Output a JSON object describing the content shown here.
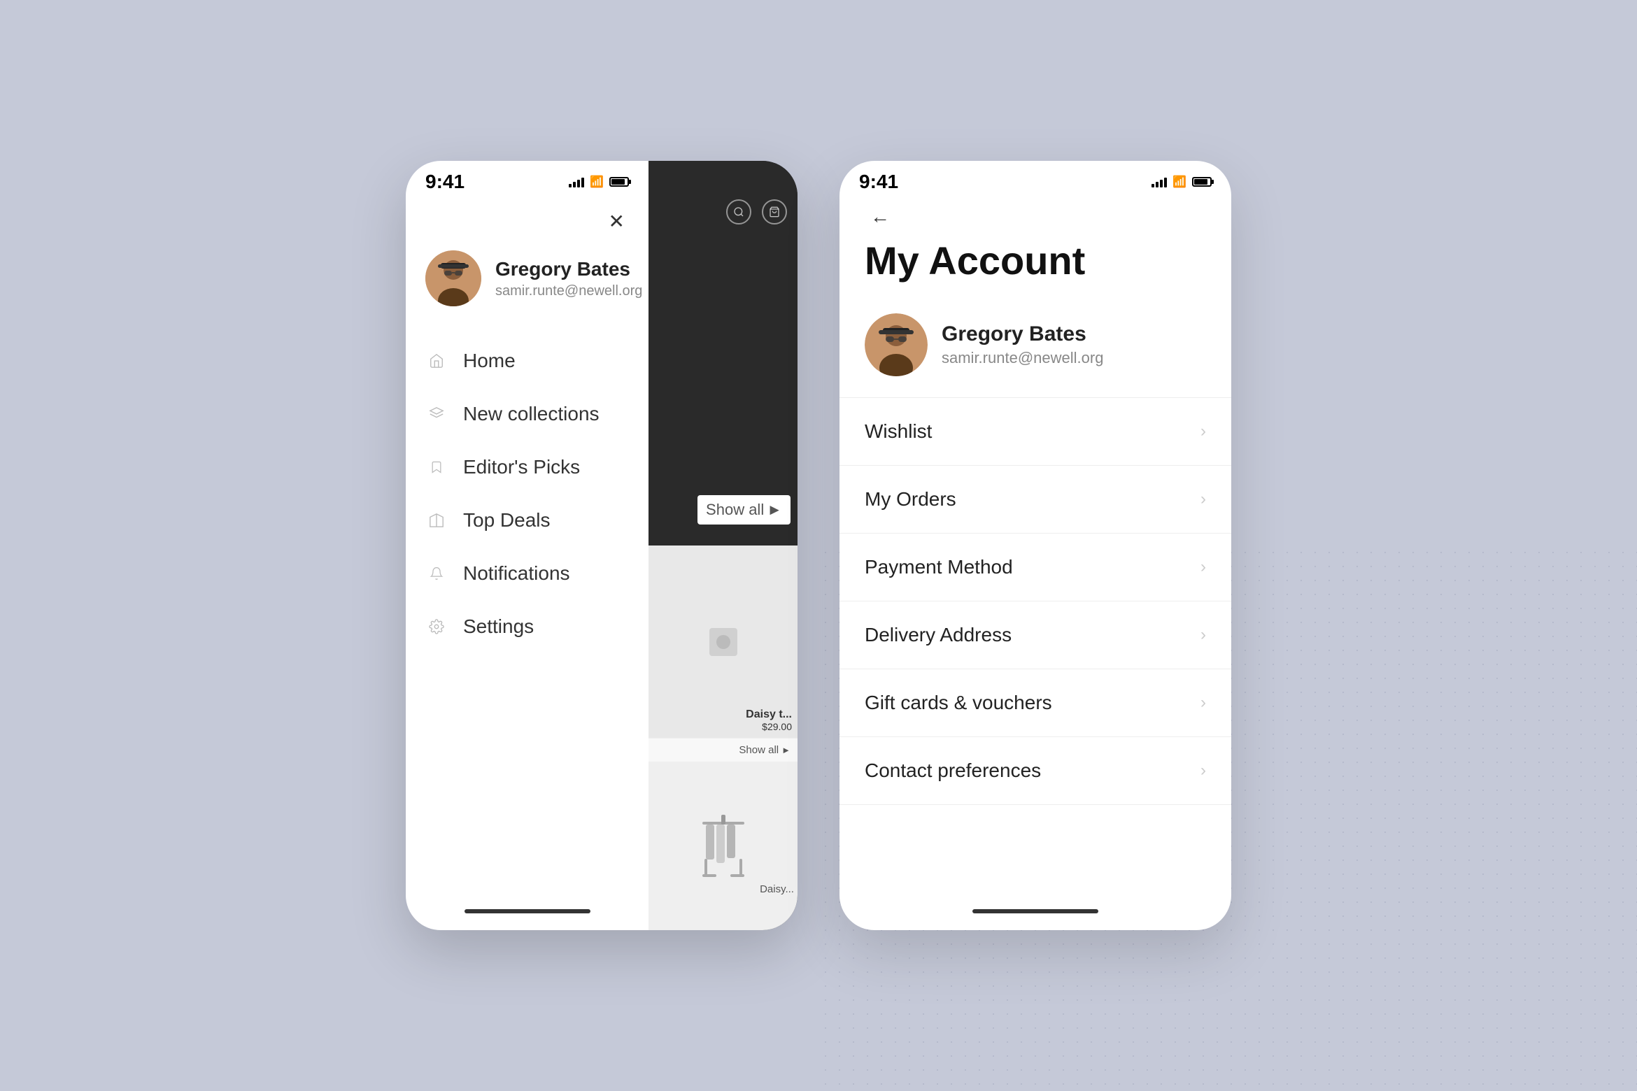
{
  "background": {
    "color": "#c5c9d8"
  },
  "phone_menu": {
    "status_bar": {
      "time": "9:41",
      "signal_bars": 4,
      "wifi": true,
      "battery": true
    },
    "close_button": "✕",
    "profile": {
      "name": "Gregory Bates",
      "email": "samir.runte@newell.org"
    },
    "nav_items": [
      {
        "label": "Home",
        "icon": "home"
      },
      {
        "label": "New collections",
        "icon": "layers"
      },
      {
        "label": "Editor's Picks",
        "icon": "bookmark"
      },
      {
        "label": "Top Deals",
        "icon": "tag"
      },
      {
        "label": "Notifications",
        "icon": "bell"
      },
      {
        "label": "Settings",
        "icon": "settings"
      }
    ],
    "app_behind": {
      "product_name": "Daisy t...",
      "product_price": "$29.00",
      "show_all": "Show all"
    }
  },
  "phone_account": {
    "status_bar": {
      "time": "9:41",
      "signal_bars": 4,
      "wifi": true,
      "battery": true
    },
    "back_button": "←",
    "title": "My Account",
    "profile": {
      "name": "Gregory Bates",
      "email": "samir.runte@newell.org"
    },
    "menu_items": [
      {
        "label": "Wishlist"
      },
      {
        "label": "My Orders"
      },
      {
        "label": "Payment Method"
      },
      {
        "label": "Delivery Address"
      },
      {
        "label": "Gift cards & vouchers"
      },
      {
        "label": "Contact preferences"
      }
    ],
    "chevron": "›"
  }
}
